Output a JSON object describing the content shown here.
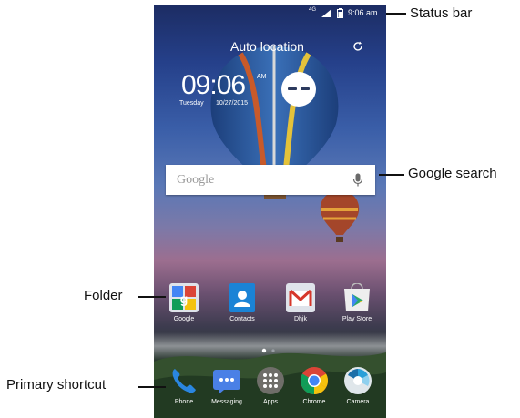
{
  "status_bar": {
    "network": "4G",
    "time": "9:06 am"
  },
  "weather": {
    "location": "Auto location",
    "time": "09:06",
    "ampm": "AM",
    "day": "Tuesday",
    "date": "10/27/2015"
  },
  "search": {
    "placeholder": "Google"
  },
  "folders": [
    {
      "label": "Google"
    },
    {
      "label": "Contacts"
    },
    {
      "label": "Dhjk"
    },
    {
      "label": "Play Store"
    }
  ],
  "dock": [
    {
      "label": "Phone"
    },
    {
      "label": "Messaging"
    },
    {
      "label": "Apps"
    },
    {
      "label": "Chrome"
    },
    {
      "label": "Camera"
    }
  ],
  "callouts": {
    "status_bar": "Status bar",
    "google_search": "Google search",
    "folder": "Folder",
    "primary_shortcut": "Primary shortcut"
  },
  "colors": {
    "phone_blue": "#2a86e0",
    "messaging_blue": "#4a80e6",
    "gmail_red": "#d6372b",
    "chrome_red": "#db4437",
    "chrome_yellow": "#f4c20d",
    "chrome_green": "#0f9d58",
    "chrome_blue": "#4285f4"
  }
}
